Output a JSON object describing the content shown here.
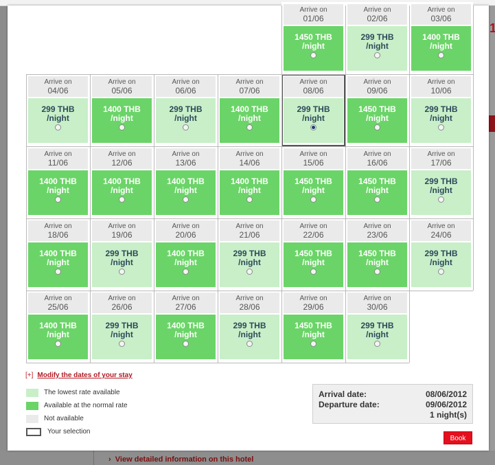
{
  "background": {
    "detail_link": "View detailed information on this hotel",
    "glyph": "1"
  },
  "calendar": {
    "arrive_label": "Arrive on",
    "night_label": "/night",
    "currency": "THB",
    "days": [
      {
        "date": "01/06",
        "price": "1450",
        "rate": "normal",
        "selected": false
      },
      {
        "date": "02/06",
        "price": "299",
        "rate": "lowest",
        "selected": false
      },
      {
        "date": "03/06",
        "price": "1400",
        "rate": "normal",
        "selected": false
      },
      {
        "date": "04/06",
        "price": "299",
        "rate": "lowest",
        "selected": false
      },
      {
        "date": "05/06",
        "price": "1400",
        "rate": "normal",
        "selected": false
      },
      {
        "date": "06/06",
        "price": "299",
        "rate": "lowest",
        "selected": false
      },
      {
        "date": "07/06",
        "price": "1400",
        "rate": "normal",
        "selected": false
      },
      {
        "date": "08/06",
        "price": "299",
        "rate": "lowest",
        "selected": true
      },
      {
        "date": "09/06",
        "price": "1450",
        "rate": "normal",
        "selected": false
      },
      {
        "date": "10/06",
        "price": "299",
        "rate": "lowest",
        "selected": false
      },
      {
        "date": "11/06",
        "price": "1400",
        "rate": "normal",
        "selected": false
      },
      {
        "date": "12/06",
        "price": "1400",
        "rate": "normal",
        "selected": false
      },
      {
        "date": "13/06",
        "price": "1400",
        "rate": "normal",
        "selected": false
      },
      {
        "date": "14/06",
        "price": "1400",
        "rate": "normal",
        "selected": false
      },
      {
        "date": "15/06",
        "price": "1450",
        "rate": "normal",
        "selected": false
      },
      {
        "date": "16/06",
        "price": "1450",
        "rate": "normal",
        "selected": false
      },
      {
        "date": "17/06",
        "price": "299",
        "rate": "lowest",
        "selected": false
      },
      {
        "date": "18/06",
        "price": "1400",
        "rate": "normal",
        "selected": false
      },
      {
        "date": "19/06",
        "price": "299",
        "rate": "lowest",
        "selected": false
      },
      {
        "date": "20/06",
        "price": "1400",
        "rate": "normal",
        "selected": false
      },
      {
        "date": "21/06",
        "price": "299",
        "rate": "lowest",
        "selected": false
      },
      {
        "date": "22/06",
        "price": "1450",
        "rate": "normal",
        "selected": false
      },
      {
        "date": "23/06",
        "price": "1450",
        "rate": "normal",
        "selected": false
      },
      {
        "date": "24/06",
        "price": "299",
        "rate": "lowest",
        "selected": false
      },
      {
        "date": "25/06",
        "price": "1400",
        "rate": "normal",
        "selected": false
      },
      {
        "date": "26/06",
        "price": "299",
        "rate": "lowest",
        "selected": false
      },
      {
        "date": "27/06",
        "price": "1400",
        "rate": "normal",
        "selected": false
      },
      {
        "date": "28/06",
        "price": "299",
        "rate": "lowest",
        "selected": false
      },
      {
        "date": "29/06",
        "price": "1450",
        "rate": "normal",
        "selected": false
      },
      {
        "date": "30/06",
        "price": "299",
        "rate": "lowest",
        "selected": false
      }
    ]
  },
  "modify": {
    "prefix": "[+]",
    "link": "Modify the dates of your stay"
  },
  "legend": {
    "lowest": "The lowest rate available",
    "normal": "Available at the normal rate",
    "unavailable": "Not available",
    "selection": "Your selection"
  },
  "summary": {
    "arrival_label": "Arrival date:",
    "arrival_value": "08/06/2012",
    "departure_label": "Departure date:",
    "departure_value": "09/06/2012",
    "nights": "1 night(s)"
  },
  "book_label": "Book",
  "colors": {
    "normal_rate": "#6bd468",
    "lowest_rate": "#c8efc8",
    "not_available": "#eaeaea",
    "book_button": "#e4101e",
    "link_red": "#b01b24"
  }
}
